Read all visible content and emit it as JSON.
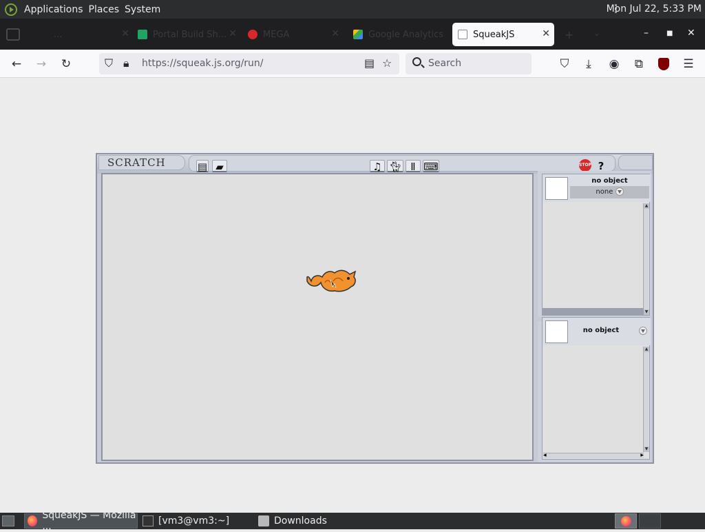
{
  "top_panel": {
    "menus": [
      "Applications",
      "Places",
      "System"
    ],
    "clock": "Mon Jul 22,  5:33 PM"
  },
  "browser": {
    "tabs": [
      {
        "label": "..."
      },
      {
        "label": "Portal Build Sh..."
      },
      {
        "label": "MEGA"
      },
      {
        "label": "Google Analytics"
      },
      {
        "label": "SqueakJS",
        "active": true
      }
    ],
    "url": "https://squeak.js.org/run/",
    "search_placeholder": "Search"
  },
  "scratch": {
    "logo": "SCRATCH",
    "sprite_viewer": {
      "name": "no object",
      "selection": "none"
    },
    "script_viewer": {
      "name": "no object"
    }
  },
  "taskbar": {
    "items": [
      {
        "label": "SqueakJS — Mozilla ..."
      },
      {
        "label": "[vm3@vm3:~]"
      },
      {
        "label": "Downloads"
      }
    ]
  },
  "colors": {
    "panel": "#2b2d2e",
    "tab_strip": "#1f1f22",
    "stage": "#e0e0e0",
    "scratch_frame": "#c5cad5",
    "stop_sign": "#d62b2b",
    "cat": "#f2922e"
  }
}
